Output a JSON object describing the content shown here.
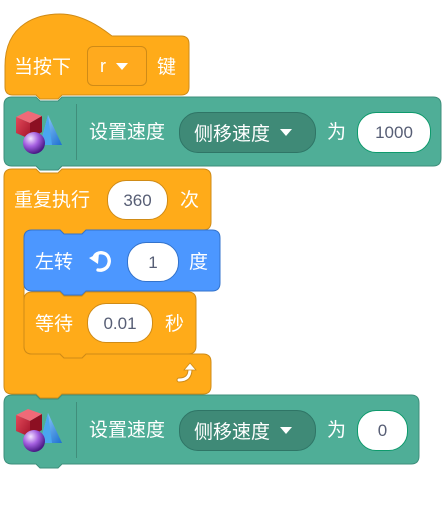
{
  "hat_block": {
    "prefix": "当按下",
    "key_value": "r",
    "suffix": "键"
  },
  "set_speed_1": {
    "label": "设置速度",
    "dropdown": "侧移速度",
    "to_label": "为",
    "value": "1000"
  },
  "repeat_block": {
    "label": "重复执行",
    "count": "360",
    "unit": "次"
  },
  "turn_block": {
    "label": "左转",
    "value": "1",
    "unit": "度"
  },
  "wait_block": {
    "label": "等待",
    "value": "0.01",
    "unit": "秒"
  },
  "set_speed_2": {
    "label": "设置速度",
    "dropdown": "侧移速度",
    "to_label": "为",
    "value": "0"
  },
  "colors": {
    "events": "#ffbf00",
    "control": "#ffab19",
    "motion_ext": "#4fae97",
    "turn": "#4c97ff"
  },
  "icons": [
    "robot-extension-icon",
    "rotate-left-icon",
    "loop-arrow-icon",
    "dropdown-arrow-icon"
  ]
}
